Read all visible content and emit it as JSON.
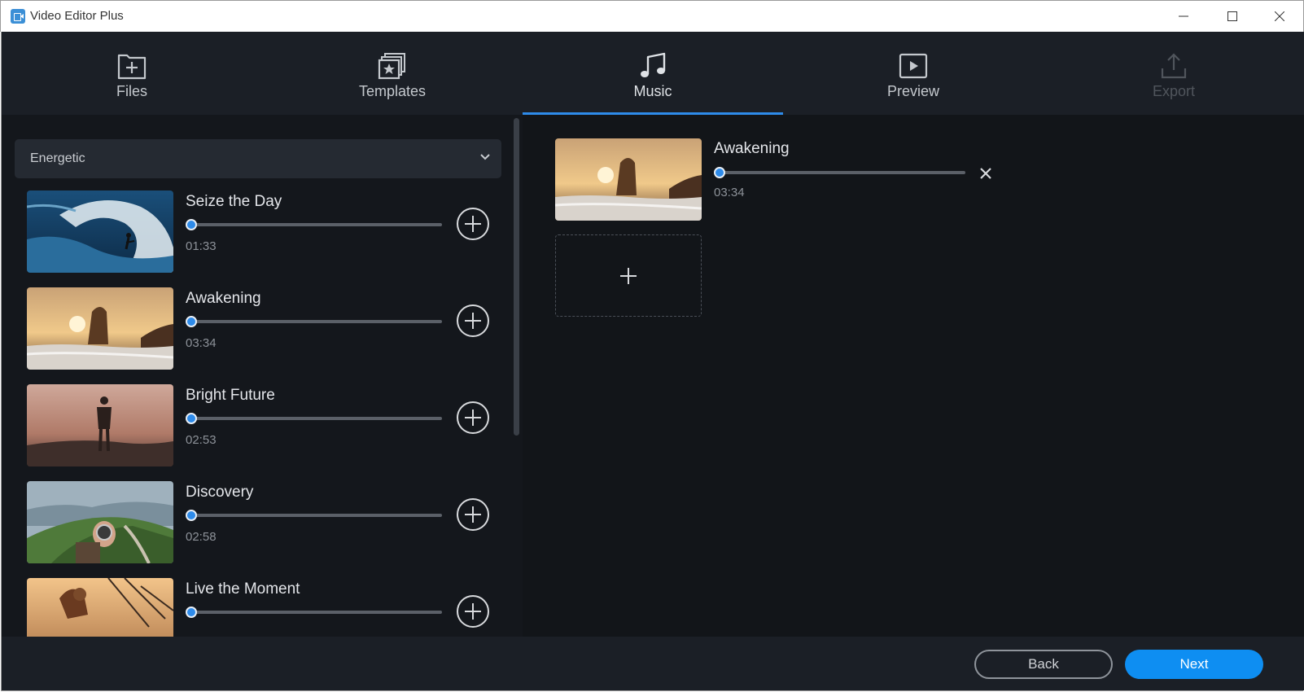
{
  "window": {
    "title": "Video Editor Plus",
    "controls": [
      "minimize",
      "maximize",
      "close"
    ]
  },
  "nav": {
    "active": "Music",
    "accent_color": "#2e8bea",
    "items": [
      {
        "label": "Files",
        "icon": "folder-plus-icon",
        "state": "normal"
      },
      {
        "label": "Templates",
        "icon": "templates-star-icon",
        "state": "normal"
      },
      {
        "label": "Music",
        "icon": "music-note-icon",
        "state": "active"
      },
      {
        "label": "Preview",
        "icon": "play-icon",
        "state": "normal"
      },
      {
        "label": "Export",
        "icon": "export-icon",
        "state": "disabled"
      }
    ]
  },
  "library": {
    "genre": "Energetic",
    "tracks": [
      {
        "name": "Seize the Day",
        "duration": "01:33",
        "thumbnail": "surfer-wave",
        "progress": 0
      },
      {
        "name": "Awakening",
        "duration": "03:34",
        "thumbnail": "sunrise-beach-rocks",
        "progress": 0
      },
      {
        "name": "Bright Future",
        "duration": "02:53",
        "thumbnail": "person-sunset",
        "progress": 0
      },
      {
        "name": "Discovery",
        "duration": "02:58",
        "thumbnail": "hand-compass-mountains",
        "progress": 0
      },
      {
        "name": "Live the Moment",
        "duration": "",
        "thumbnail": "woman-swing-sunset",
        "progress": 0
      }
    ]
  },
  "selected": {
    "name": "Awakening",
    "duration": "03:34",
    "thumbnail": "sunrise-beach-rocks",
    "progress": 0
  },
  "footer": {
    "back_label": "Back",
    "next_label": "Next",
    "next_color": "#0e8ef2"
  }
}
